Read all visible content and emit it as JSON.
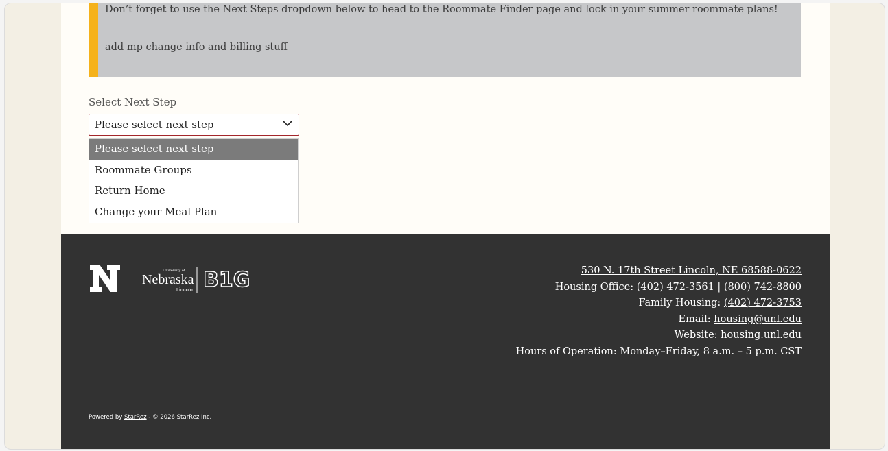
{
  "notice": {
    "line1": "Don’t forget to use the Next Steps dropdown below to head to the Roommate Finder page and lock in your summer roommate plans!",
    "line2": "add mp change info and billing stuff"
  },
  "next_step": {
    "label": "Select Next Step",
    "selected": "Please select next step",
    "options": [
      "Please select next step",
      "Roommate Groups",
      "Return Home",
      "Change your Meal Plan"
    ]
  },
  "logos": {
    "n_icon": "nebraska-n-logo",
    "nebraska_top": "University of",
    "nebraska": "Nebraska",
    "nebraska_sub": "Lincoln",
    "big": "B1G"
  },
  "footer": {
    "address": "530 N. 17th Street Lincoln, NE 68588-0622",
    "housing_office_label": "Housing Office: ",
    "housing_office_phone1": "(402) 472-3561",
    "housing_office_sep": " | ",
    "housing_office_phone2": "(800) 742-8800",
    "family_label": "Family Housing: ",
    "family_phone": "(402) 472-3753",
    "email_label": "Email: ",
    "email": "housing@unl.edu",
    "website_label": "Website: ",
    "website": "housing.unl.edu",
    "hours": "Hours of Operation: Monday–Friday, 8 a.m. – 5 p.m. CST",
    "powered_prefix": "Powered by ",
    "powered_link": "StarRez",
    "powered_suffix": " - © 2026 StarRez Inc."
  },
  "colors": {
    "accent_border": "#a3262c",
    "notice_bar": "#f5b21b",
    "footer_bg": "#323232"
  }
}
